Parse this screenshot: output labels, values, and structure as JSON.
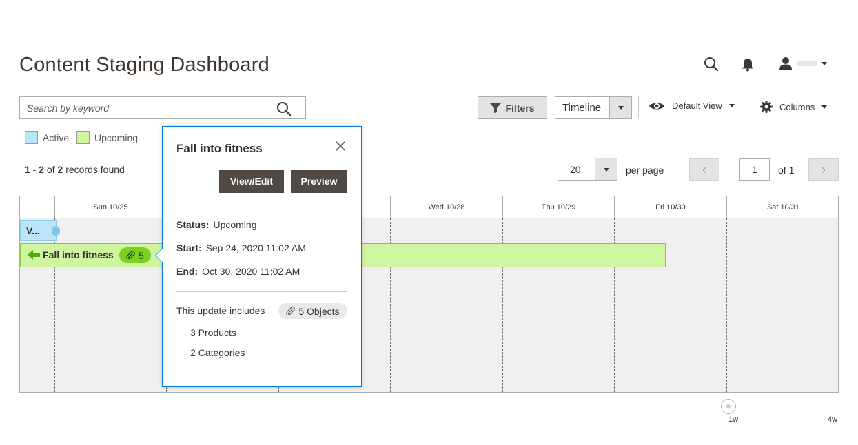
{
  "page": {
    "title": "Content Staging Dashboard"
  },
  "header": {
    "search_icon": "search-icon",
    "bell_icon": "bell-icon",
    "user_icon": "user-icon"
  },
  "search": {
    "placeholder": "Search by keyword",
    "icon": "search-icon"
  },
  "toolbar": {
    "filters_label": "Filters",
    "view_mode": "Timeline",
    "default_view_label": "Default View",
    "columns_label": "Columns"
  },
  "legend": [
    {
      "label": "Active",
      "color": "#bde5f8"
    },
    {
      "label": "Upcoming",
      "color": "#d0f5a0"
    }
  ],
  "records": {
    "from": "1",
    "sep": " - ",
    "to": "2",
    "of_text": " of ",
    "total": "2",
    "suffix": " records found"
  },
  "pagination": {
    "per_page": "20",
    "per_page_label": "per page",
    "current_page": "1",
    "of_label": "of 1",
    "prev": "‹",
    "next": "›"
  },
  "timeline": {
    "days": [
      "",
      "Sun 10/25",
      "",
      "",
      "Wed 10/28",
      "Thu 10/29",
      "Fri 10/30",
      "Sat 10/31"
    ],
    "active_bar": {
      "label": "V..."
    },
    "upcoming_bar": {
      "label": "Fall into fitness",
      "objects": "5"
    }
  },
  "popup": {
    "title": "Fall into fitness",
    "view_edit_label": "View/Edit",
    "preview_label": "Preview",
    "status_label": "Status:",
    "status_value": "Upcoming",
    "start_label": "Start:",
    "start_value": "Sep 24, 2020 11:02 AM",
    "end_label": "End:",
    "end_value": "Oct 30, 2020 11:02 AM",
    "includes_label": "This update includes",
    "objects_label": "5 Objects",
    "items": [
      "3 Products",
      "2 Categories"
    ]
  },
  "zoom": {
    "min_label": "1w",
    "max_label": "4w"
  }
}
